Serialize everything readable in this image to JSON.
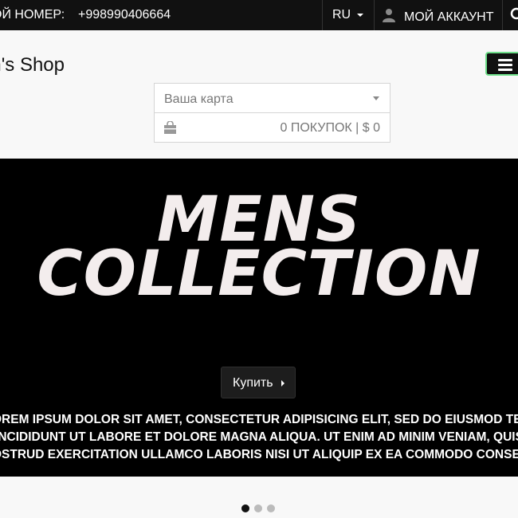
{
  "topbar": {
    "phone_label": "ОЙ НОМЕР:",
    "phone_number": "+998990406664",
    "language": "RU",
    "account_label": "МОЙ АККАУНТ",
    "icons": [
      "user-icon",
      "search-icon",
      "caret-down-icon"
    ]
  },
  "header": {
    "shop_title": "en's Shop",
    "menu_icon": "hamburger-icon"
  },
  "cart": {
    "select_value": "Ваша карта",
    "summary": "0 ПОКУПОК | $ 0",
    "icon": "shopping-bag-icon"
  },
  "hero": {
    "title_line1": "MENS",
    "title_line2": "COLLECTION",
    "buy_label": "Купить",
    "lorem_lines": [
      "OREM IPSUM DOLOR SIT AMET, CONSECTETUR ADIPISICING ELIT, SED DO EIUSMOD TEMPO",
      "INCIDIDUNT UT LABORE ET DOLORE MAGNA ALIQUA. UT ENIM AD MINIM VENIAM, QUIS",
      "OSTRUD EXERCITATION ULLAMCO LABORIS NISI UT ALIQUIP EX EA COMMODO CONSEQUA"
    ]
  },
  "carousel": {
    "slide_count": 3,
    "active_index": 0
  },
  "colors": {
    "topbar_bg": "#111111",
    "hero_bg": "#000000",
    "hero_text": "#f3eded",
    "menu_toggle_border": "#6fe08b",
    "page_bg": "#f8f8f8"
  }
}
